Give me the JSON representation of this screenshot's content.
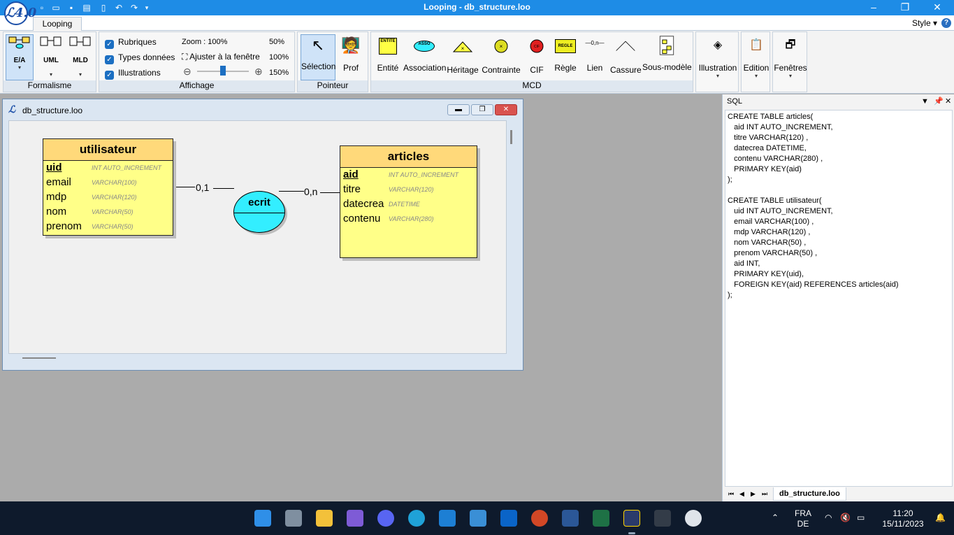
{
  "app": {
    "window_title": "Looping - db_structure.loo",
    "logo_text": "ℒ4.0"
  },
  "tabs": {
    "looping": "Looping",
    "style": "Style ▾",
    "help": "?"
  },
  "ribbon": {
    "formalisme": {
      "label": "Formalisme",
      "buttons": [
        {
          "label": "E/A"
        },
        {
          "label": "UML"
        },
        {
          "label": "MLD"
        }
      ]
    },
    "affichage": {
      "label": "Affichage",
      "checks": [
        {
          "label": "Rubriques",
          "checked": true
        },
        {
          "label": "Types données",
          "checked": true
        },
        {
          "label": "Illustrations",
          "checked": true
        }
      ],
      "zoom_label": "Zoom : 100%",
      "fit_label": "Ajuster à la fenêtre",
      "zoom_options": [
        "50%",
        "100%",
        "150%"
      ],
      "zoom_value": 100
    },
    "pointeur": {
      "label": "Pointeur",
      "buttons": [
        "Sélection",
        "Prof"
      ]
    },
    "mcd": {
      "label": "MCD",
      "buttons": [
        "Entité",
        "Association",
        "Héritage",
        "Contrainte",
        "CIF",
        "Règle",
        "Lien",
        "Cassure",
        "Sous-modèle"
      ]
    },
    "extra": [
      "Illustration",
      "Edition",
      "Fenêtres"
    ],
    "icon_texts": {
      "entite": "ENTITE",
      "asso": "ASSO",
      "regle": "REGLE",
      "lien": "—0,n—",
      "cif": "CIF"
    }
  },
  "document": {
    "title": "db_structure.loo",
    "entities": [
      {
        "name": "utilisateur",
        "attributes": [
          {
            "name": "uid",
            "type": "INT AUTO_INCREMENT",
            "pk": true
          },
          {
            "name": "email",
            "type": "VARCHAR(100)",
            "pk": false
          },
          {
            "name": "mdp",
            "type": "VARCHAR(120)",
            "pk": false
          },
          {
            "name": "nom",
            "type": "VARCHAR(50)",
            "pk": false
          },
          {
            "name": "prenom",
            "type": "VARCHAR(50)",
            "pk": false
          }
        ]
      },
      {
        "name": "articles",
        "attributes": [
          {
            "name": "aid",
            "type": "INT AUTO_INCREMENT",
            "pk": true
          },
          {
            "name": "titre",
            "type": "VARCHAR(120)",
            "pk": false
          },
          {
            "name": "datecrea",
            "type": "DATETIME",
            "pk": false
          },
          {
            "name": "contenu",
            "type": "VARCHAR(280)",
            "pk": false
          }
        ]
      }
    ],
    "association": {
      "name": "ecrit",
      "card_left": "0,1",
      "card_right": "0,n"
    }
  },
  "sql_panel": {
    "title": "SQL",
    "lines": [
      "CREATE TABLE articles(",
      "   aid INT AUTO_INCREMENT,",
      "   titre VARCHAR(120) ,",
      "   datecrea DATETIME,",
      "   contenu VARCHAR(280) ,",
      "   PRIMARY KEY(aid)",
      ");",
      "",
      "CREATE TABLE utilisateur(",
      "   uid INT AUTO_INCREMENT,",
      "   email VARCHAR(100) ,",
      "   mdp VARCHAR(120) ,",
      "   nom VARCHAR(50) ,",
      "   prenom VARCHAR(50) ,",
      "   aid INT,",
      "   PRIMARY KEY(uid),",
      "   FOREIGN KEY(aid) REFERENCES articles(aid)",
      ");"
    ],
    "tab_label": "db_structure.loo"
  },
  "taskbar": {
    "lang": "FRA",
    "layout": "DE",
    "time": "11:20",
    "date": "15/11/2023",
    "apps": [
      "Start",
      "Task View",
      "File Explorer",
      "Proton VPN",
      "Discord",
      "Edge",
      "VS Code",
      "Notepad",
      "Outlook",
      "PowerPoint",
      "Word",
      "Excel",
      "Looping",
      "Terminal",
      "Chrome"
    ]
  }
}
